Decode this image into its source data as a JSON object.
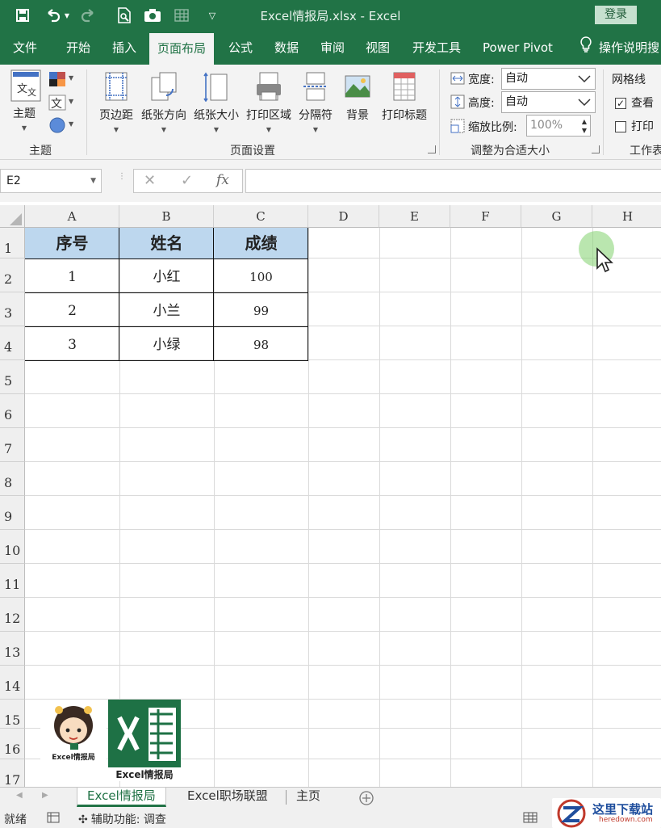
{
  "window": {
    "title": "Excel情报局.xlsx  -  Excel",
    "login_label": "登录"
  },
  "ribbon_tabs": [
    "文件",
    "开始",
    "插入",
    "页面布局",
    "公式",
    "数据",
    "审阅",
    "视图",
    "开发工具",
    "Power Pivot"
  ],
  "ribbon_active_tab": "页面布局",
  "tell_me": "操作说明搜",
  "ribbon": {
    "themes_group": {
      "label": "主题",
      "theme_btn": "主题"
    },
    "page_setup_group": {
      "label": "页面设置",
      "buttons": [
        "页边距",
        "纸张方向",
        "纸张大小",
        "打印区域",
        "分隔符",
        "背景",
        "打印标题"
      ]
    },
    "scale_group": {
      "label": "调整为合适大小",
      "width_label": "宽度:",
      "width_value": "自动",
      "height_label": "高度:",
      "height_value": "自动",
      "scale_label": "缩放比例:",
      "scale_value": "100%"
    },
    "sheet_options_group": {
      "label": "工作表",
      "gridlines_label": "网格线",
      "view_label": "查看",
      "view_checked": true,
      "print_label": "打印",
      "print_checked": false
    }
  },
  "formula_bar": {
    "name_box": "E2",
    "cancel_glyph": "✕",
    "enter_glyph": "✓",
    "fx_glyph": "fx",
    "formula": ""
  },
  "sheet": {
    "columns": [
      "A",
      "B",
      "C",
      "D",
      "E",
      "F",
      "G",
      "H"
    ],
    "rows": [
      "1",
      "2",
      "3",
      "4",
      "5",
      "6",
      "7",
      "8",
      "9",
      "10",
      "11",
      "12",
      "13",
      "14",
      "15",
      "16",
      "17"
    ],
    "table_header": [
      "序号",
      "姓名",
      "成绩"
    ],
    "table_rows": [
      [
        "1",
        "小红",
        "100"
      ],
      [
        "2",
        "小兰",
        "99"
      ],
      [
        "3",
        "小绿",
        "98"
      ]
    ]
  },
  "logo": {
    "avatar_caption": "Excel情报局",
    "footer_caption": "Excel情报局"
  },
  "sheet_tabs": [
    "Excel情报局",
    "Excel职场联盟",
    "主页"
  ],
  "active_sheet": "Excel情报局",
  "status": {
    "ready": "就绪",
    "accessibility": "辅助功能: 调查"
  },
  "watermark": {
    "name": "这里下载站",
    "url": "heredown.com"
  },
  "colors": {
    "excel_green": "#217346",
    "header_fill": "#bdd7ee"
  }
}
